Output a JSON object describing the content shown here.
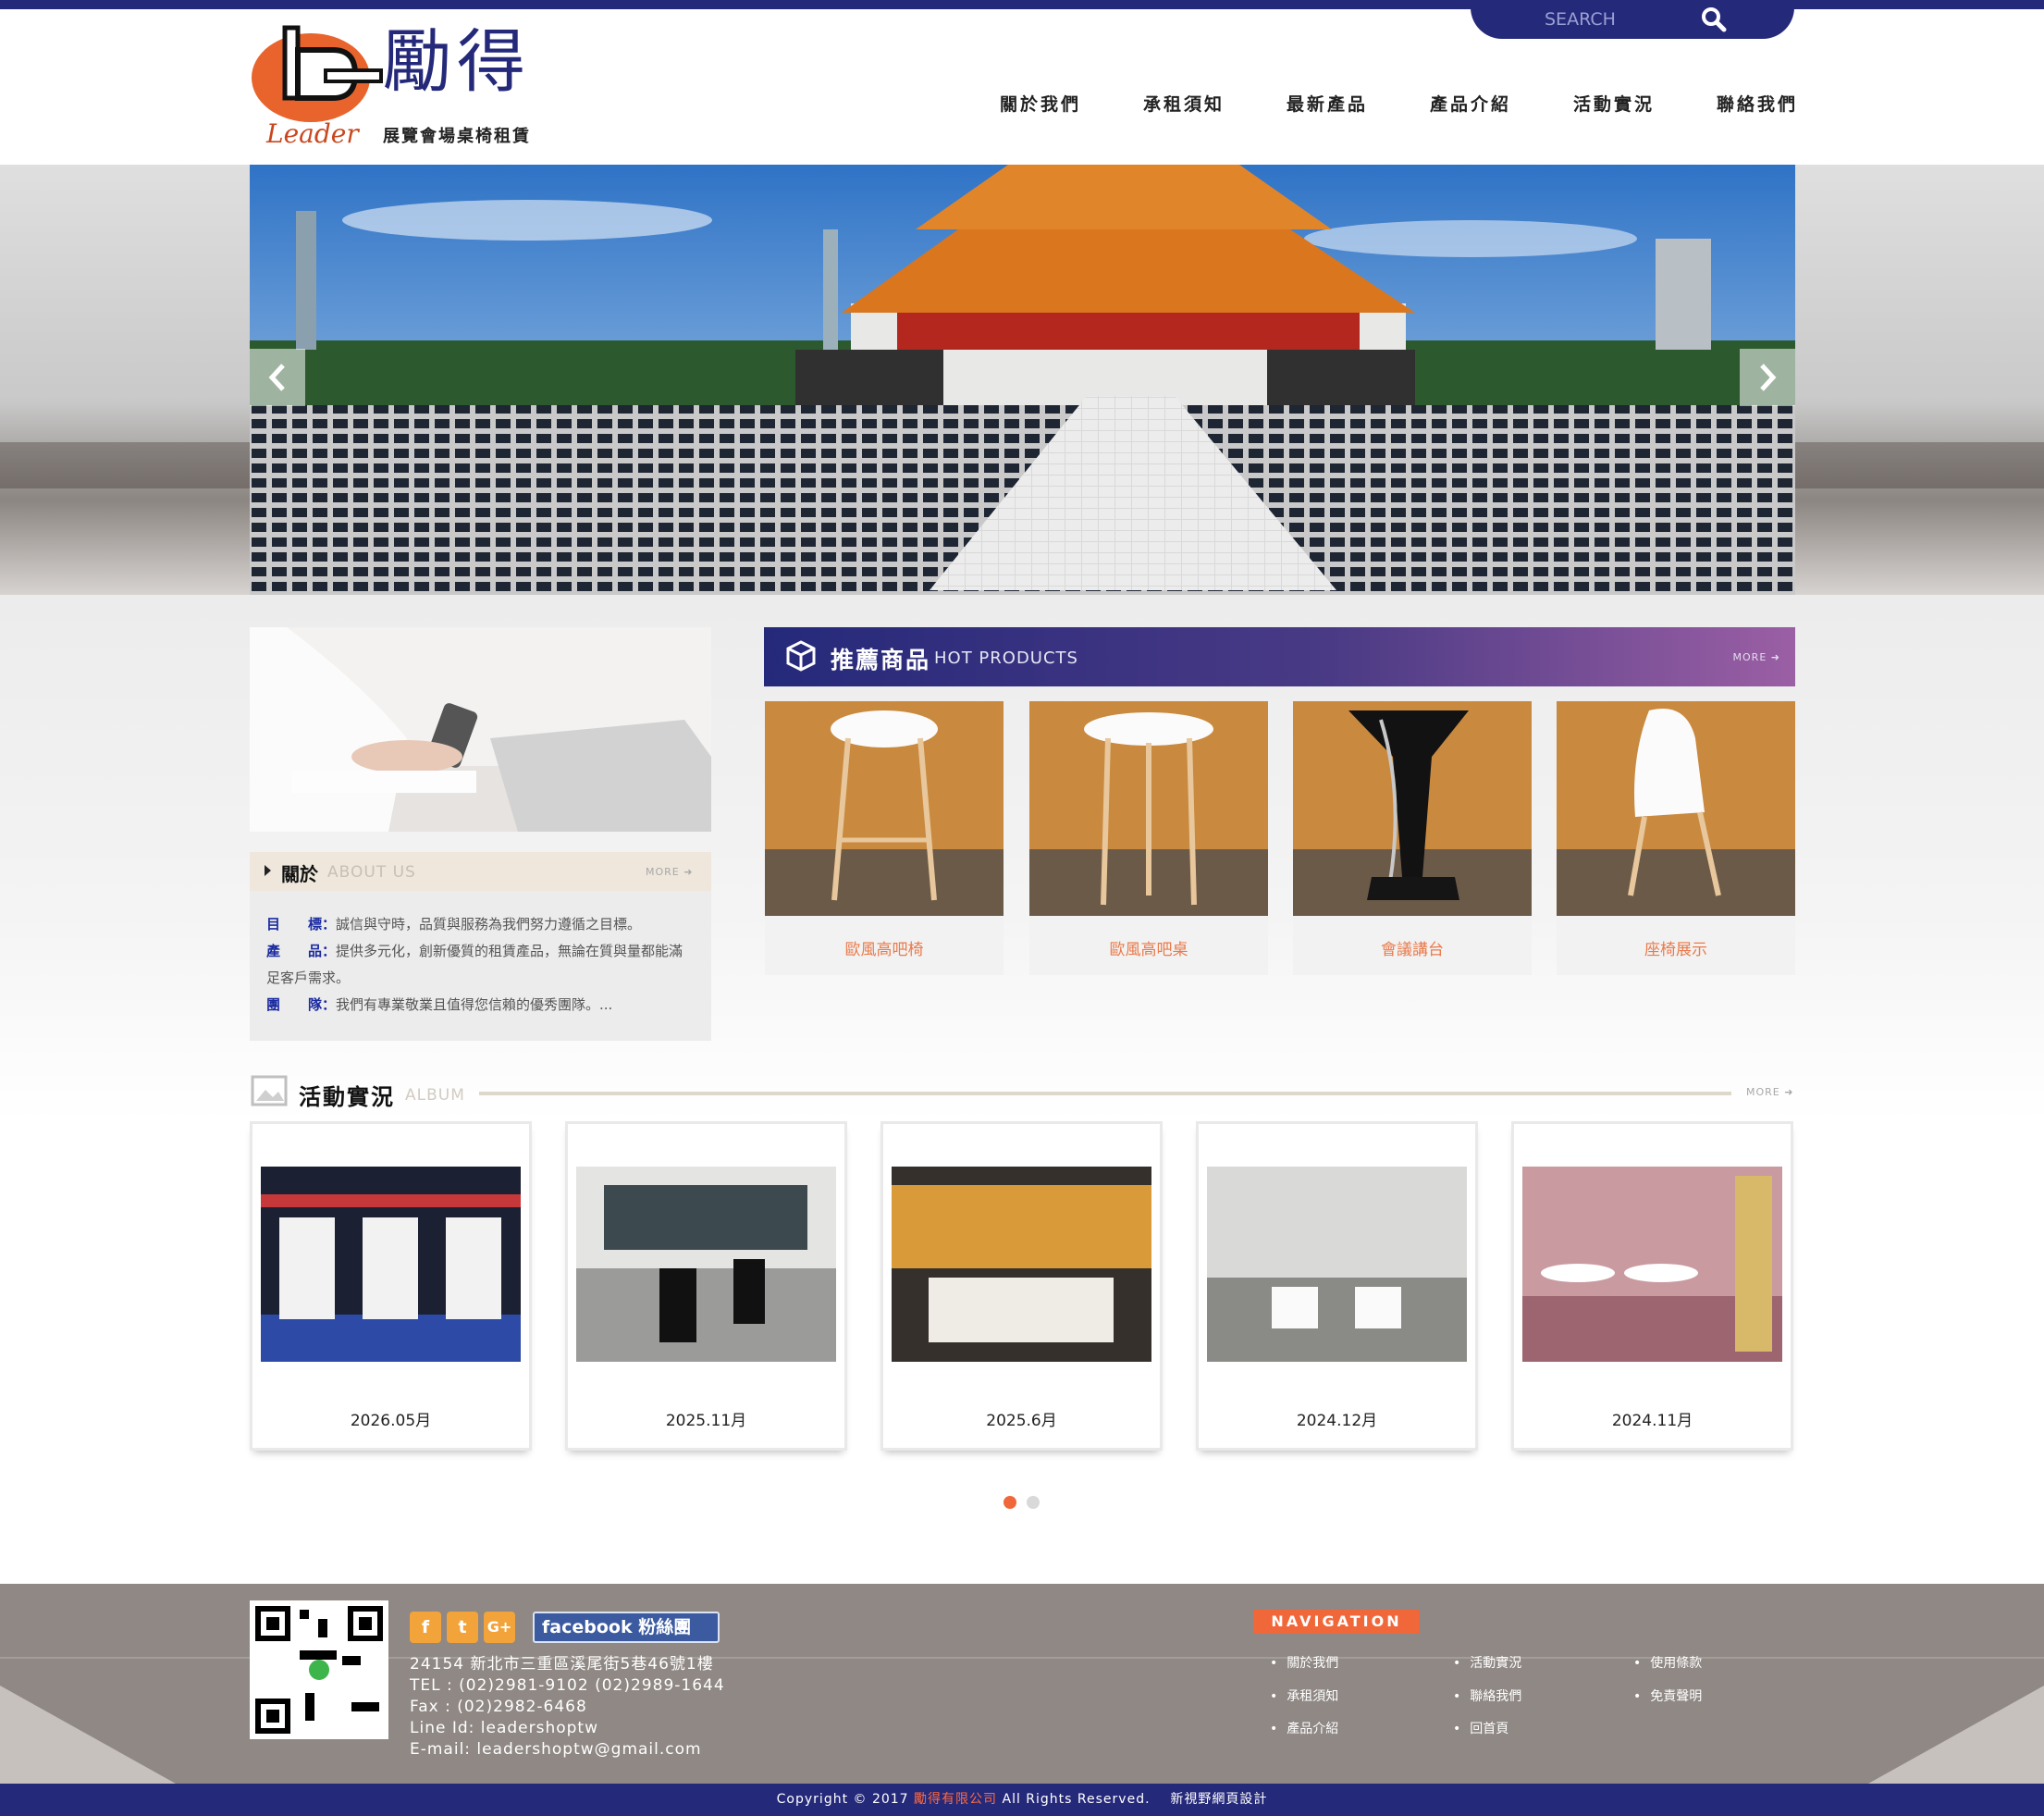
{
  "search": {
    "placeholder": "SEARCH"
  },
  "brand": {
    "title": "勵得",
    "subtitle": "展覽會場桌椅租賃",
    "logo_text": "Leader"
  },
  "nav": [
    {
      "label": "關於我們"
    },
    {
      "label": "承租須知"
    },
    {
      "label": "最新產品"
    },
    {
      "label": "產品介紹"
    },
    {
      "label": "活動實況"
    },
    {
      "label": "聯絡我們"
    }
  ],
  "hero": {
    "prev_icon": "chevron-left-icon",
    "next_icon": "chevron-right-icon"
  },
  "about": {
    "title": "關於",
    "subtitle": "ABOUT US",
    "more": "MORE",
    "lines": [
      {
        "key": "目　　標：",
        "text": "誠信與守時，品質與服務為我們努力遵循之目標。"
      },
      {
        "key": "產　　品：",
        "text": "提供多元化，創新優質的租賃產品，無論在質與量都能滿足客戶需求。"
      },
      {
        "key": "團　　隊：",
        "text": "我們有專業敬業且值得您信賴的優秀團隊。..."
      }
    ]
  },
  "hot": {
    "title": "推薦商品",
    "subtitle": "HOT PRODUCTS",
    "more": "MORE",
    "products": [
      {
        "name": "歐風高吧椅"
      },
      {
        "name": "歐風高吧桌"
      },
      {
        "name": "會議講台"
      },
      {
        "name": "座椅展示"
      }
    ]
  },
  "album": {
    "title": "活動實況",
    "subtitle": "ALBUM",
    "more": "MORE",
    "items": [
      {
        "label": "2026.05月"
      },
      {
        "label": "2025.11月"
      },
      {
        "label": "2025.6月"
      },
      {
        "label": "2024.12月"
      },
      {
        "label": "2024.11月"
      }
    ],
    "pager": {
      "current": 1,
      "total": 2
    }
  },
  "footer": {
    "social": [
      "f",
      "t",
      "G+"
    ],
    "facebook_label": "facebook 粉絲團",
    "address": "24154 新北市三重區溪尾街5巷46號1樓",
    "tel": "TEL : (02)2981-9102  (02)2989-1644",
    "fax": "Fax : (02)2982-6468",
    "line": "Line Id: leadershoptw",
    "email": "E-mail: leadershoptw@gmail.com",
    "nav_title": "NAVIGATION",
    "nav_links": [
      "關於我們",
      "承租須知",
      "產品介紹",
      "活動實況",
      "聯絡我們",
      "回首頁",
      "使用條款",
      "免責聲明"
    ],
    "copyright_pre": "Copyright © 2017 ",
    "company": "勵得有限公司",
    "copyright_post": " All Rights Reserved.",
    "designer": "新視野網頁設計"
  },
  "colors": {
    "brand_navy": "#25297a",
    "accent_orange": "#f0673a",
    "product_label": "#ea7a4a"
  }
}
